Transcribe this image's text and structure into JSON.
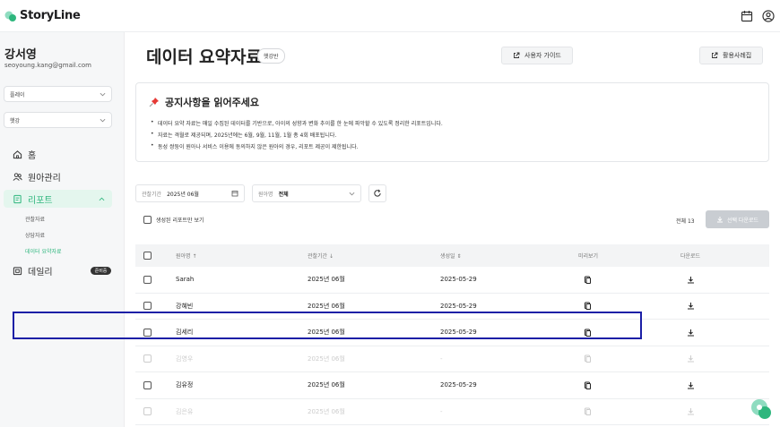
{
  "app": {
    "name": "StoryLine"
  },
  "user": {
    "name": "강서영",
    "email": "seoyoung.kang@gmail.com"
  },
  "sidebar": {
    "select1": "플레이",
    "select2": "햇강",
    "nav": [
      {
        "label": "홈"
      },
      {
        "label": "원아관리"
      },
      {
        "label": "리포트"
      },
      {
        "label": "데일리",
        "badge": "준비중"
      }
    ],
    "sub": [
      "관찰자료",
      "상담자료",
      "데이터 요약자료"
    ]
  },
  "page": {
    "title": "데이터 요약자료",
    "badge": "햇강반",
    "guide_btn": "사용자 가이드",
    "example_btn": "활용사례집"
  },
  "notice": {
    "title": "공지사항을 읽어주세요",
    "items": [
      "데이터 요약 자료는 매일 수집된 데이터를 기반으로, 아이의 성향과 변화 추이를 한 눈에 파악할 수 있도록 정리한 리포트입니다.",
      "자료는 격월로 제공되며, 2025년에는 6월, 9월, 11월, 1월 총 4회 배포됩니다.",
      "동성 쌍둥이 원아나 서비스 이용에 동의하지 않은 원아의 경우, 리포트 제공이 제한됩니다."
    ]
  },
  "filters": {
    "period_label": "관찰기간",
    "period_value": "2025년 06월",
    "child_label": "원아명",
    "child_value": "전체"
  },
  "controls": {
    "generated_only": "생성된 리포트만 보기",
    "total": "전체 13",
    "download_selected": "선택 다운로드"
  },
  "table": {
    "headers": {
      "name": "원아명",
      "period": "관찰기간",
      "date": "생성일",
      "preview": "미리보기",
      "download": "다운로드"
    },
    "rows": [
      {
        "name": "Sarah",
        "period": "2025년 06월",
        "date": "2025-05-29"
      },
      {
        "name": "강혜빈",
        "period": "2025년 06월",
        "date": "2025-05-29"
      },
      {
        "name": "김세리",
        "period": "2025년 06월",
        "date": "2025-05-29"
      },
      {
        "name": "김영우",
        "period": "2025년 06월",
        "date": "-"
      },
      {
        "name": "김유정",
        "period": "2025년 06월",
        "date": "2025-05-29"
      },
      {
        "name": "김은유",
        "period": "2025년 06월",
        "date": "-"
      }
    ]
  },
  "colors": {
    "brand": "#2eb67d",
    "highlight": "#1c1fa6"
  }
}
